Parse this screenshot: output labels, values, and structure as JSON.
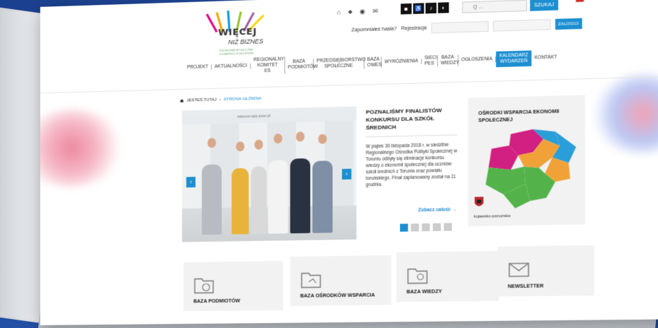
{
  "logo": {
    "line1": "WIĘCEJ",
    "line2": "NIŻ BIZNES",
    "sub": "EKONOMIA SPOŁECZNA KUJAWSKO-POMORSKIE"
  },
  "header": {
    "top_icons": [
      "⌂",
      "♣",
      "◉",
      "✉"
    ],
    "access_icons": [
      "■",
      "♿",
      "♪",
      "◐"
    ],
    "search_placeholder": "Q ...",
    "search_button": "SZUKAJ",
    "forgot_password": "Zapomniałeś hasła?",
    "register": "Rejestracja",
    "login_button": "ZALOGUJ"
  },
  "nav": [
    {
      "label": "PROJEKT"
    },
    {
      "label": "AKTUALNOŚCI"
    },
    {
      "label": "REGIONALNY KOMITET ES"
    },
    {
      "label": "BAZA PODMIOTÓW"
    },
    {
      "label": "PRZEDSIĘBIORSTWO SPOŁECZNE"
    },
    {
      "label": "BAZA OWES"
    },
    {
      "label": "WYRÓŻNIENIA"
    },
    {
      "label": "SIECI PES"
    },
    {
      "label": "BAZA WIEDZY"
    },
    {
      "label": "OGŁOSZENIA"
    },
    {
      "label": "KALENDARZ WYDARZEŃ"
    },
    {
      "label": "KONTAKT"
    }
  ],
  "breadcrumb": {
    "label": "JESTEŚ TUTAJ",
    "current": "STRONA GŁÓWNA"
  },
  "slider": {
    "banner": "www.es.rops.torun.pl",
    "prev": "‹",
    "next": "›",
    "title": "POZNALIŚMY FINALISTÓW KONKURSU DLA SZKÓŁ ŚREDNICH",
    "body": "W piątek 30 listopada 2018 r. w siedzibie Regionalnego Ośrodka Polityki Społecznej w Toruniu odbyły się eliminacje konkursu wiedzy o ekonomii społecznej dla uczniów szkół średnich z Torunia oraz powiatu toruńskiego. Finał zaplanowany został na 11 grudnia.",
    "more": "Zobacz całość →",
    "dots": 5,
    "active_dot": 0
  },
  "map": {
    "title": "OŚRODKI WSPARCIA EKONOMII SPOŁECZNEJ",
    "region": "kujawsko-pomorskie"
  },
  "tiles": [
    {
      "label": "BAZA PODMIOTÓW"
    },
    {
      "label": "BAZA OŚRODKÓW WSPARCIA"
    },
    {
      "label": "BAZA WIEDZY"
    },
    {
      "label": "NEWSLETTER"
    }
  ],
  "colors": {
    "accent": "#1d8fd1",
    "background": "#1f4a9b"
  }
}
